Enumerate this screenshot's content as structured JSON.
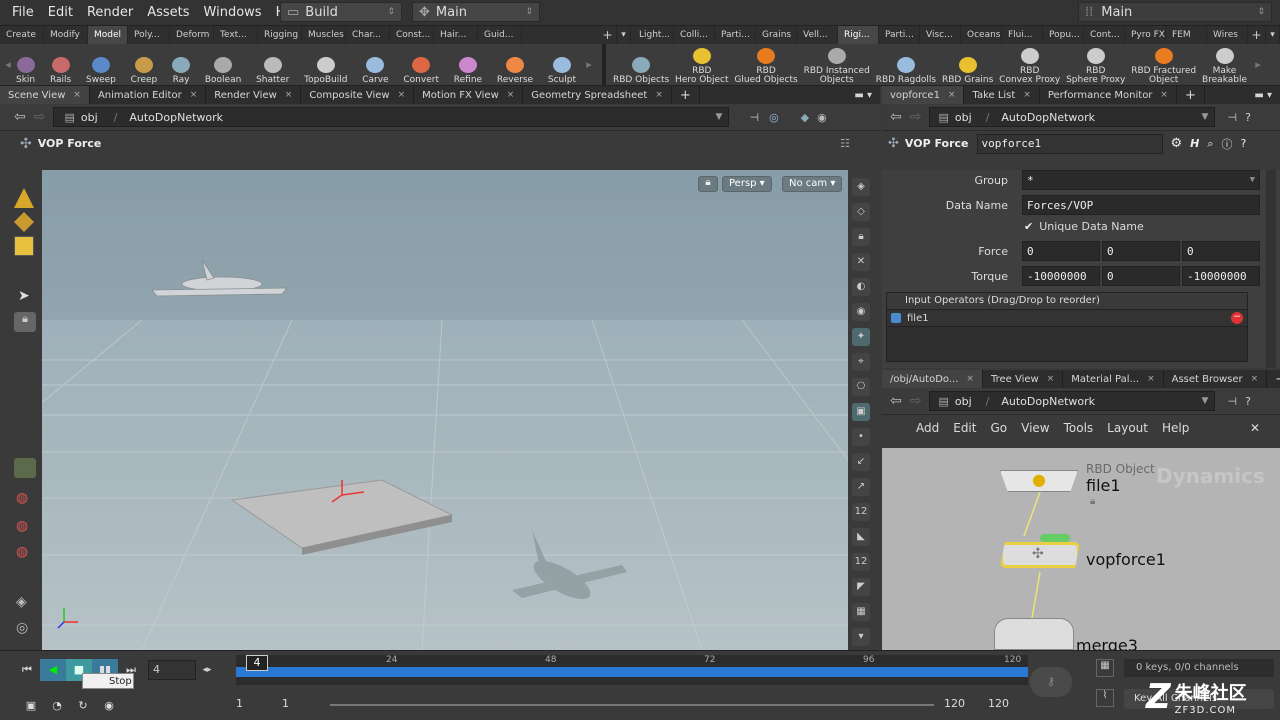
{
  "menu": {
    "items": [
      "File",
      "Edit",
      "Render",
      "Assets",
      "Windows",
      "Help"
    ],
    "desktop": "Build",
    "context": "Main",
    "workspace": "Main"
  },
  "shelf_tabs_left": [
    "Create",
    "Modify",
    "Model",
    "Poly...",
    "Deform",
    "Text...",
    "Rigging",
    "Muscles",
    "Char...",
    "Const...",
    "Hair...",
    "Guid..."
  ],
  "shelf_tabs_right": [
    "Light...",
    "Colli...",
    "Parti...",
    "Grains",
    "Vell...",
    "Rigi...",
    "Parti...",
    "Visc...",
    "Oceans",
    "Flui...",
    "Popu...",
    "Cont...",
    "Pyro FX",
    "FEM",
    "Wires"
  ],
  "tools_left": [
    "Skin",
    "Rails",
    "Sweep",
    "Creep",
    "Ray",
    "Boolean",
    "Shatter",
    "TopoBuild",
    "Carve",
    "Convert",
    "Refine",
    "Reverse",
    "Sculpt"
  ],
  "tools_right": [
    {
      "l1": "RBD Objects",
      "l2": ""
    },
    {
      "l1": "RBD",
      "l2": "Hero Object"
    },
    {
      "l1": "RBD",
      "l2": "Glued Objects"
    },
    {
      "l1": "RBD Instanced",
      "l2": "Objects"
    },
    {
      "l1": "RBD Ragdolls",
      "l2": ""
    },
    {
      "l1": "RBD Grains",
      "l2": ""
    },
    {
      "l1": "RBD",
      "l2": "Convex Proxy"
    },
    {
      "l1": "RBD",
      "l2": "Sphere Proxy"
    },
    {
      "l1": "RBD Fractured",
      "l2": "Object"
    },
    {
      "l1": "Make",
      "l2": "Breakable"
    }
  ],
  "left_pane_tabs": [
    "Scene View",
    "Animation Editor",
    "Render View",
    "Composite View",
    "Motion FX View",
    "Geometry Spreadsheet"
  ],
  "path": {
    "root": "obj",
    "node": "AutoDopNetwork"
  },
  "viewport": {
    "title": "VOP Force",
    "persp": "Persp",
    "cam": "No cam"
  },
  "right_top_tabs": [
    "vopforce1",
    "Take List",
    "Performance Monitor"
  ],
  "params": {
    "type": "VOP Force",
    "name": "vopforce1",
    "group_label": "Group",
    "group_value": "*",
    "dataname_label": "Data Name",
    "dataname_value": "Forces/VOP",
    "unique_label": "Unique Data Name",
    "force_label": "Force",
    "force": [
      "0",
      "0",
      "0"
    ],
    "torque_label": "Torque",
    "torque": [
      "-10000000",
      "0",
      "-10000000"
    ],
    "inputs_header": "Input Operators (Drag/Drop to reorder)",
    "input1": "file1"
  },
  "right_bottom_tabs": [
    "/obj/AutoDo...",
    "Tree View",
    "Material Pal...",
    "Asset Browser"
  ],
  "network_menu": [
    "Add",
    "Edit",
    "Go",
    "View",
    "Tools",
    "Layout",
    "Help"
  ],
  "network": {
    "watermark": "Dynamics",
    "n1_type": "RBD Object",
    "n1": "file1",
    "n2": "vopforce1",
    "n3": "merge3"
  },
  "timeline": {
    "frame": "4",
    "frame_field": "4",
    "ticks": [
      "24",
      "48",
      "72",
      "96"
    ],
    "end_label": "120",
    "start": "1",
    "start2": "1",
    "end": "120",
    "end2": "120",
    "tooltip": "Stop",
    "channels": "0 keys, 0/0 channels",
    "keyall": "Key All Channels"
  },
  "logo": {
    "text": "朱峰社区",
    "sub": "ZF3D.COM"
  }
}
